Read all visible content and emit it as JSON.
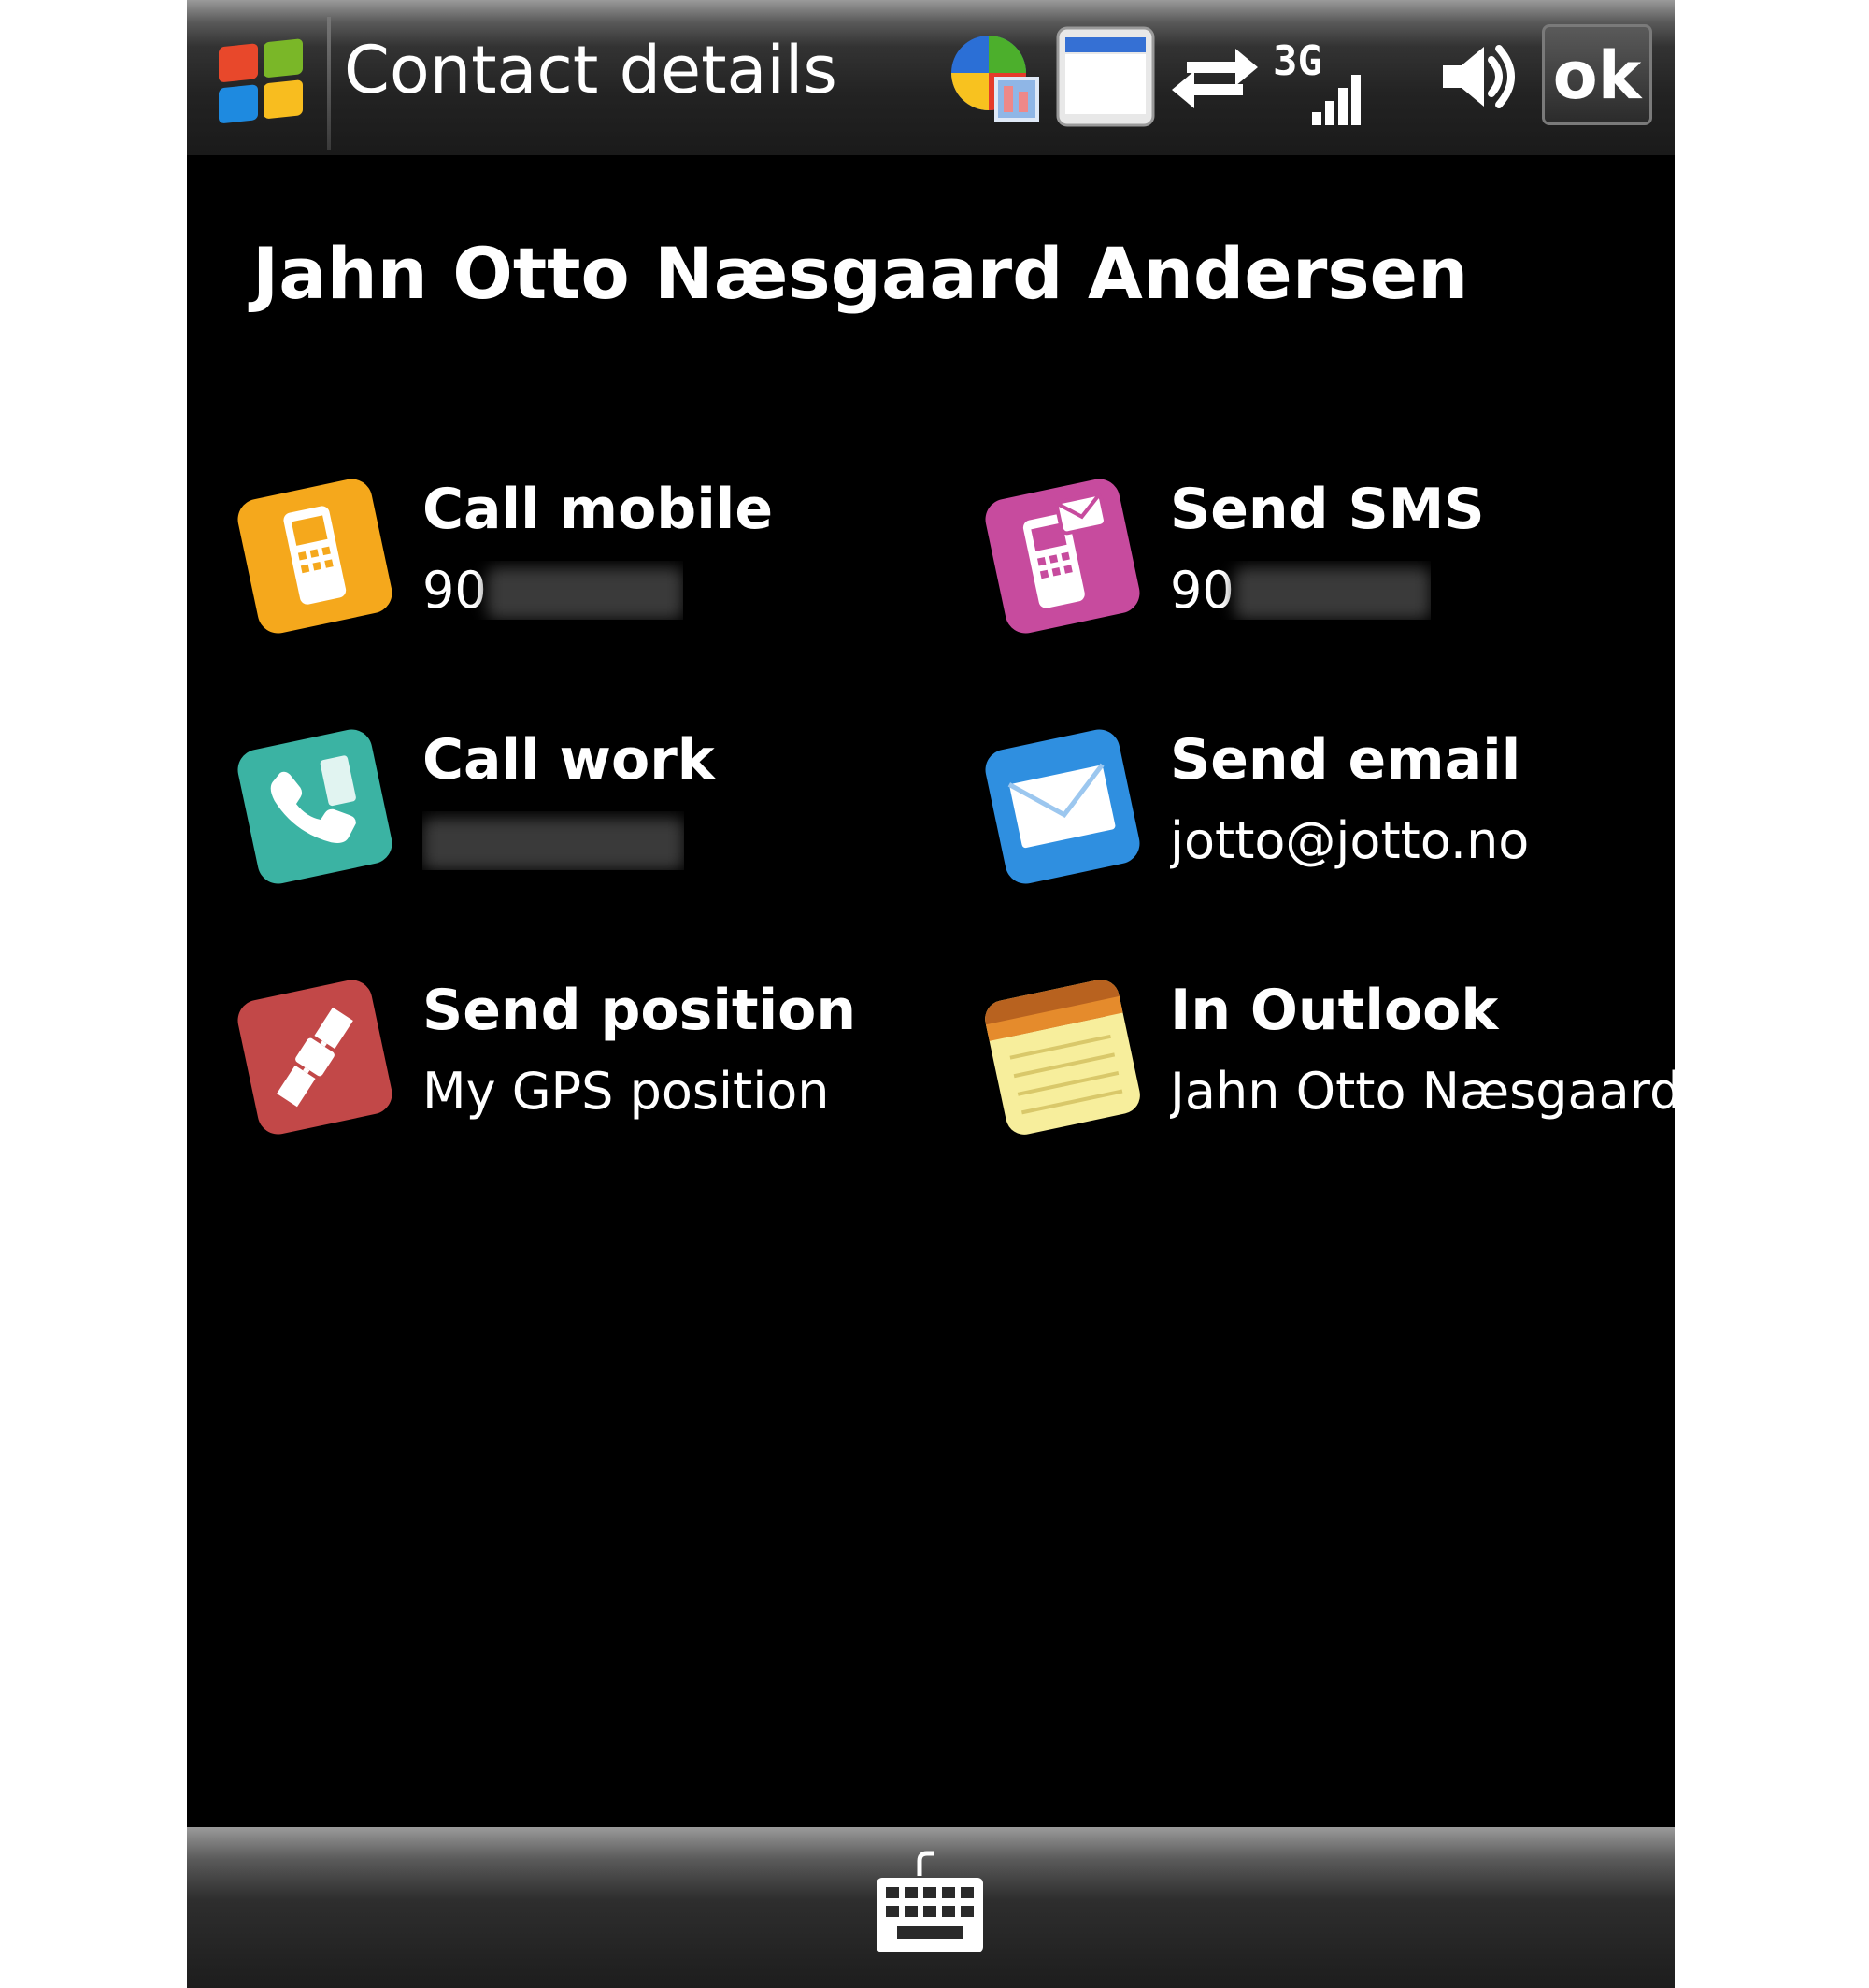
{
  "titlebar": {
    "title": "Contact details",
    "ok_label": "ok",
    "status_icons": [
      "windows-start-icon",
      "today-plugin-icon",
      "window-icon",
      "sync-arrows-icon",
      "signal-3g-icon",
      "volume-icon"
    ]
  },
  "contact": {
    "name": "Jahn Otto Næsgaard Andersen"
  },
  "actions": [
    {
      "label": "Call mobile",
      "value": "90",
      "value_redacted": true,
      "icon": "mobile-phone-icon",
      "color": "#f5a81c"
    },
    {
      "label": "Send SMS",
      "value": "90",
      "value_redacted": true,
      "icon": "sms-phone-icon",
      "color": "#c74b9e"
    },
    {
      "label": "Call work",
      "value": "",
      "value_redacted": true,
      "icon": "desk-phone-icon",
      "color": "#3bb3a3"
    },
    {
      "label": "Send email",
      "value": "jotto@jotto.no",
      "value_redacted": false,
      "icon": "envelope-icon",
      "color": "#2f8fe0"
    },
    {
      "label": "Send position",
      "value": "My GPS position",
      "value_redacted": false,
      "icon": "satellite-icon",
      "color": "#c24848"
    },
    {
      "label": "In Outlook",
      "value": "Jahn Otto Næsgaard",
      "value_redacted": false,
      "icon": "notepad-icon",
      "color": "#f3e59a"
    }
  ],
  "softkeys": {
    "center_icon": "keyboard-icon"
  }
}
